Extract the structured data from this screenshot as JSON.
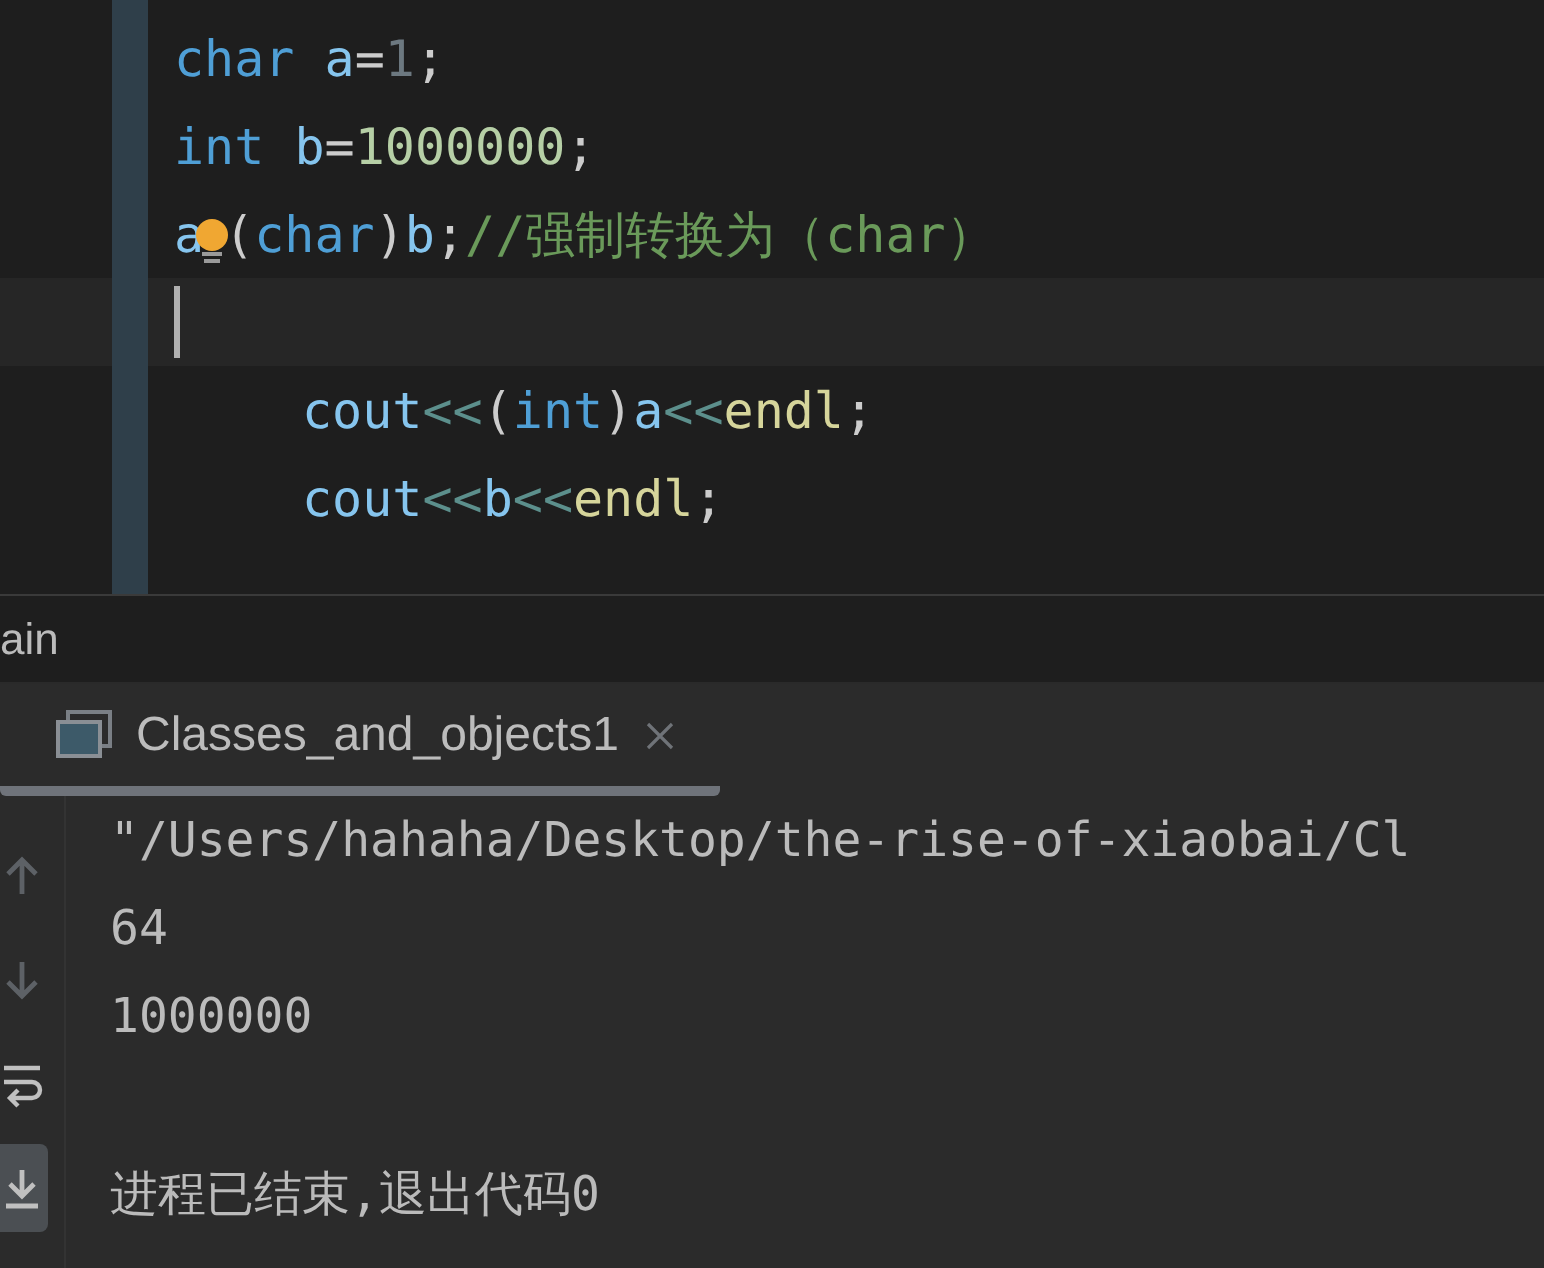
{
  "editor": {
    "lines": [
      {
        "current": false,
        "indented": false,
        "tokens": [
          {
            "text": "char ",
            "kind": "keyword"
          },
          {
            "text": "a",
            "kind": "variable"
          },
          {
            "text": "=",
            "kind": "punct"
          },
          {
            "text": "1",
            "kind": "dim"
          },
          {
            "text": ";",
            "kind": "punct"
          }
        ]
      },
      {
        "current": false,
        "indented": false,
        "tokens": [
          {
            "text": "int ",
            "kind": "keyword"
          },
          {
            "text": "b",
            "kind": "variable"
          },
          {
            "text": "=",
            "kind": "punct"
          },
          {
            "text": "1000000",
            "kind": "number"
          },
          {
            "text": ";",
            "kind": "punct"
          }
        ]
      },
      {
        "current": false,
        "indented": false,
        "tokens": [
          {
            "text": "a",
            "kind": "variable"
          },
          {
            "kind": "hint"
          },
          {
            "text": "(",
            "kind": "punct"
          },
          {
            "text": "char",
            "kind": "keyword"
          },
          {
            "text": ")",
            "kind": "punct"
          },
          {
            "text": "b",
            "kind": "variable"
          },
          {
            "text": ";",
            "kind": "punct"
          },
          {
            "text": "//强制转换为（char）",
            "kind": "comment"
          }
        ]
      },
      {
        "current": true,
        "indented": false
      },
      {
        "current": false,
        "indented": true,
        "tokens": [
          {
            "text": "cout",
            "kind": "variable"
          },
          {
            "text": "<<",
            "kind": "operator"
          },
          {
            "text": "(",
            "kind": "punct"
          },
          {
            "text": "int",
            "kind": "keyword"
          },
          {
            "text": ")",
            "kind": "punct"
          },
          {
            "text": "a",
            "kind": "variable"
          },
          {
            "text": "<<",
            "kind": "operator"
          },
          {
            "text": "endl",
            "kind": "macro"
          },
          {
            "text": ";",
            "kind": "punct"
          }
        ]
      },
      {
        "current": false,
        "indented": true,
        "tokens": [
          {
            "text": "cout",
            "kind": "variable"
          },
          {
            "text": "<<",
            "kind": "operator"
          },
          {
            "text": "b",
            "kind": "variable"
          },
          {
            "text": "<<",
            "kind": "operator"
          },
          {
            "text": "endl",
            "kind": "macro"
          },
          {
            "text": ";",
            "kind": "punct"
          }
        ]
      }
    ]
  },
  "breadcrumb": "ain",
  "run_tab": {
    "label": "Classes_and_objects1",
    "selected": true
  },
  "console_toolbar": [
    {
      "kind": "up",
      "selected": false
    },
    {
      "kind": "down",
      "selected": false
    },
    {
      "kind": "wrap",
      "selected": false
    },
    {
      "kind": "scroll_end",
      "selected": true
    }
  ],
  "output": [
    {
      "text": "\"/Users/hahaha/Desktop/the-rise-of-xiaobai/Cl",
      "kind": "command"
    },
    {
      "text": "64",
      "kind": "stdout"
    },
    {
      "text": "1000000",
      "kind": "stdout"
    },
    {
      "text": "进程已结束,退出代码0",
      "kind": "exit"
    }
  ]
}
